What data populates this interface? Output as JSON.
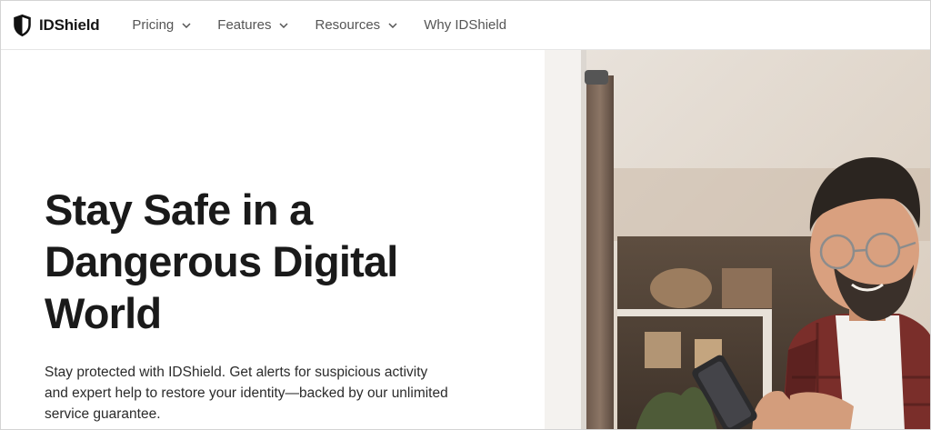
{
  "brand": {
    "name": "IDShield"
  },
  "nav": {
    "items": [
      {
        "label": "Pricing",
        "dropdown": true
      },
      {
        "label": "Features",
        "dropdown": true
      },
      {
        "label": "Resources",
        "dropdown": true
      },
      {
        "label": "Why IDShield",
        "dropdown": false
      }
    ]
  },
  "hero": {
    "headline_lines": [
      "Stay Safe in a",
      "Dangerous Digital",
      "World"
    ],
    "subtext_lines": [
      "Stay protected with IDShield. Get alerts for suspicious activity",
      "and expert help to restore your identity—backed by our unlimited",
      "service guarantee."
    ],
    "image": "smiling-man-with-glasses-using-smartphone"
  },
  "colors": {
    "text": "#1a1a1a",
    "nav_text": "#555555",
    "background": "#ffffff"
  }
}
